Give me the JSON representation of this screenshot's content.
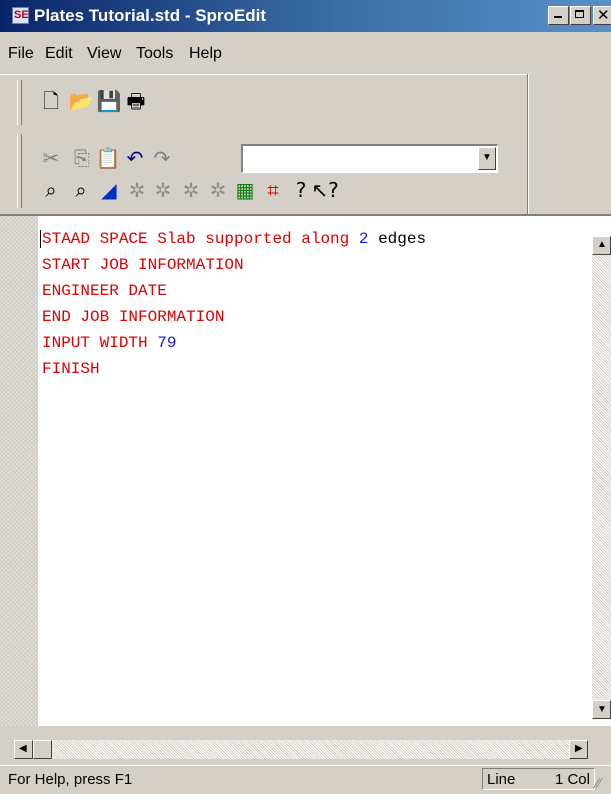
{
  "window": {
    "title": "Plates Tutorial.std - SproEdit",
    "app_icon": "SE",
    "controls": {
      "minimize": "minimize",
      "maximize": "maximize",
      "close": "close"
    }
  },
  "menu": [
    "File",
    "Edit",
    "View",
    "Tools",
    "Help"
  ],
  "toolbar": {
    "row1": [
      {
        "name": "new-file-icon",
        "glyph": "🗋",
        "color": "#000"
      },
      {
        "name": "open-folder-icon",
        "glyph": "📂",
        "color": "#a07800"
      },
      {
        "name": "save-icon",
        "glyph": "💾",
        "color": "#000"
      },
      {
        "name": "print-icon",
        "glyph": "🖶",
        "color": "#000"
      }
    ],
    "row2": [
      {
        "name": "cut-icon",
        "glyph": "✂",
        "color": "#808080"
      },
      {
        "name": "copy-icon",
        "glyph": "⎘",
        "color": "#808080"
      },
      {
        "name": "paste-icon",
        "glyph": "📋",
        "color": "#000"
      },
      {
        "name": "undo-icon",
        "glyph": "↶",
        "color": "#000080"
      },
      {
        "name": "redo-icon",
        "glyph": "↷",
        "color": "#808080"
      }
    ],
    "combo_value": "",
    "row3": [
      {
        "name": "find-icon",
        "glyph": "⌕",
        "color": "#000"
      },
      {
        "name": "find-next-icon",
        "glyph": "⌕",
        "color": "#000"
      },
      {
        "name": "bookmark-icon",
        "glyph": "◢",
        "color": "#0030c0"
      },
      {
        "name": "tool-icon-1",
        "glyph": "✲",
        "color": "#909090"
      },
      {
        "name": "tool-icon-2",
        "glyph": "✲",
        "color": "#909090"
      },
      {
        "name": "tool-icon-3",
        "glyph": "✲",
        "color": "#909090"
      },
      {
        "name": "tool-icon-4",
        "glyph": "✲",
        "color": "#909090"
      },
      {
        "name": "calculator-icon",
        "glyph": "▦",
        "color": "#108010"
      },
      {
        "name": "grid-icon",
        "glyph": "⌗",
        "color": "#e00000"
      },
      {
        "name": "help-icon",
        "glyph": "?",
        "color": "#000"
      },
      {
        "name": "context-help-icon",
        "glyph": "↖?",
        "color": "#000"
      }
    ]
  },
  "editor": {
    "lines": [
      [
        {
          "t": "STAAD SPACE Slab supported along ",
          "c": "kw"
        },
        {
          "t": "2",
          "c": "num"
        },
        {
          "t": " edges",
          "c": "plain"
        }
      ],
      [
        {
          "t": "START JOB INFORMATION",
          "c": "kw"
        }
      ],
      [
        {
          "t": "ENGINEER DATE",
          "c": "kw"
        }
      ],
      [
        {
          "t": "END JOB INFORMATION",
          "c": "kw"
        }
      ],
      [
        {
          "t": "INPUT WIDTH ",
          "c": "kw"
        },
        {
          "t": "79",
          "c": "num"
        }
      ],
      [
        {
          "t": "FINISH",
          "c": "kw"
        }
      ]
    ]
  },
  "status": {
    "help_text": "For Help, press F1",
    "line_label": "Line",
    "col_label": "1 Col"
  }
}
